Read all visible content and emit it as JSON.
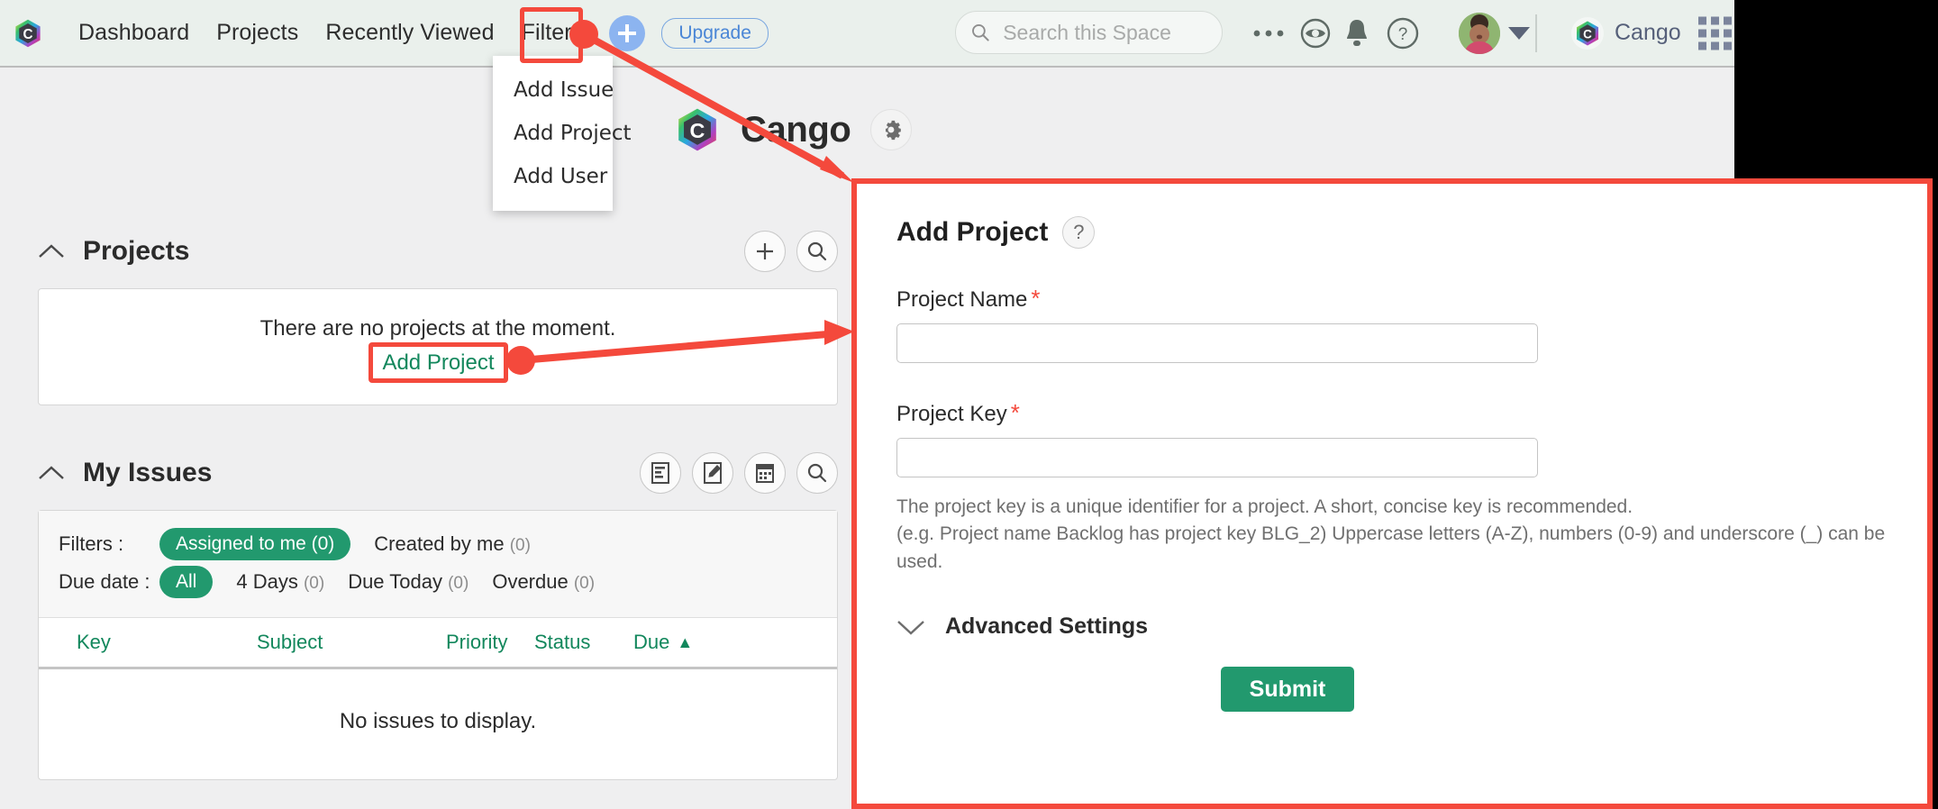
{
  "topnav": {
    "links": [
      {
        "label": "Dashboard"
      },
      {
        "label": "Projects"
      },
      {
        "label": "Recently Viewed"
      },
      {
        "label": "Filters"
      }
    ],
    "add_button_label": "+",
    "upgrade_label": "Upgrade",
    "search_placeholder": "Search this Space",
    "search_value": "",
    "space_label": "Cango"
  },
  "dropdown": {
    "items": [
      {
        "label": "Add Issue"
      },
      {
        "label": "Add Project"
      },
      {
        "label": "Add User"
      }
    ]
  },
  "space_header": {
    "title": "Cango"
  },
  "projects_section": {
    "title": "Projects",
    "empty_text": "There are no projects at the moment.",
    "add_project_label": "Add Project"
  },
  "issues_section": {
    "title": "My Issues",
    "filters_label": "Filters :",
    "due_date_label": "Due date :",
    "filter_options": [
      {
        "label": "Assigned to me",
        "count": "(0)",
        "active": true
      },
      {
        "label": "Created by me",
        "count": "(0)",
        "active": false
      }
    ],
    "due_options": [
      {
        "label": "All",
        "count": "",
        "active": true
      },
      {
        "label": "4 Days",
        "count": "(0)",
        "active": false
      },
      {
        "label": "Due Today",
        "count": "(0)",
        "active": false
      },
      {
        "label": "Overdue",
        "count": "(0)",
        "active": false
      }
    ],
    "columns": [
      {
        "label": "Key"
      },
      {
        "label": "Subject"
      },
      {
        "label": "Priority"
      },
      {
        "label": "Status"
      },
      {
        "label": "Due",
        "sort": "▲"
      }
    ],
    "empty_text": "No issues to display."
  },
  "add_project_panel": {
    "title": "Add Project",
    "help_glyph": "?",
    "project_name_label": "Project Name",
    "project_name_value": "",
    "project_key_label": "Project Key",
    "project_key_value": "",
    "required_marker": "*",
    "help_line_1": "The project key is a unique identifier for a project. A short, concise key is recommended.",
    "help_line_2": "(e.g. Project name Backlog has project key BLG_2) Uppercase letters (A-Z), numbers (0-9) and underscore (_) can be used.",
    "advanced_settings_label": "Advanced Settings",
    "submit_label": "Submit"
  },
  "colors": {
    "accent_green": "#22996e",
    "annotation_red": "#f4493c",
    "nav_bg": "#eaf0ec",
    "link_blue": "#4a86d6",
    "body_bg": "#efeff0"
  }
}
